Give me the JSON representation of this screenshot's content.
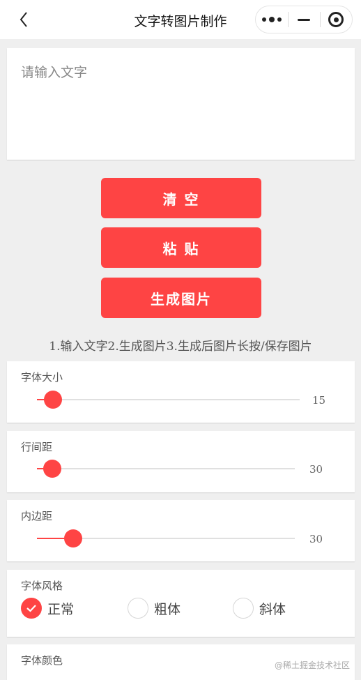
{
  "nav": {
    "title": "文字转图片制作",
    "back_icon": "chevron-left-icon",
    "more_icon": "more-dots-icon",
    "minimize_icon": "minimize-icon",
    "close_icon": "target-icon"
  },
  "input": {
    "placeholder": "请输入文字",
    "value": ""
  },
  "buttons": {
    "clear": "清 空",
    "paste": "粘 贴",
    "generate": "生成图片"
  },
  "tip": "1.输入文字2.生成图片3.生成后图片长按/保存图片",
  "font_size": {
    "label": "字体大小",
    "value": "15",
    "fraction": 0.06
  },
  "line_spacing": {
    "label": "行间距",
    "value": "30",
    "fraction": 0.06
  },
  "padding": {
    "label": "内边距",
    "value": "30",
    "fraction": 0.14
  },
  "font_style": {
    "label": "字体风格",
    "options": [
      "正常",
      "粗体",
      "斜体"
    ],
    "selected": "正常"
  },
  "font_color": {
    "label": "字体颜色"
  },
  "colors": {
    "accent": "#fe4444",
    "background": "#efefef"
  },
  "watermark": "@稀土掘金技术社区"
}
